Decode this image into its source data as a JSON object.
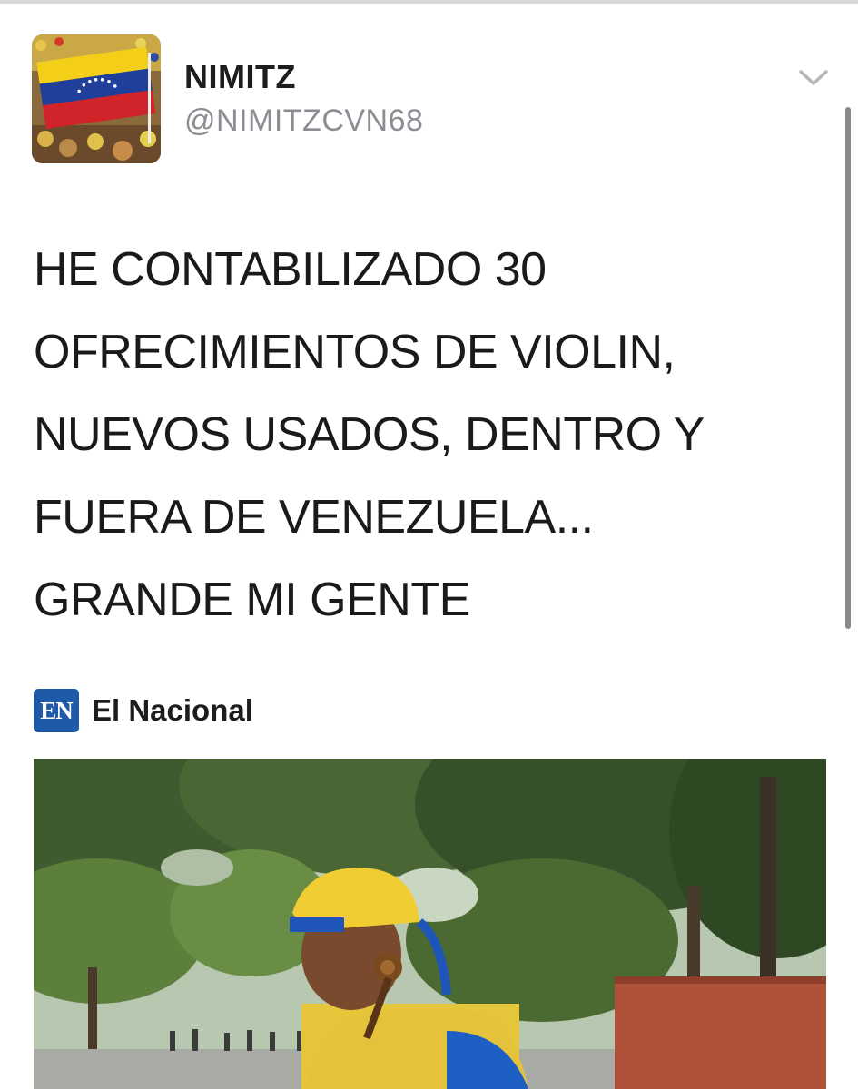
{
  "tweet": {
    "author": {
      "display_name": "NIMITZ",
      "handle": "@NIMITZCVN68"
    },
    "text_lines": [
      "HE CONTABILIZADO 30",
      "OFRECIMIENTOS DE VIOLIN,",
      "NUEVOS USADOS, DENTRO Y",
      "FUERA DE VENEZUELA...",
      "GRANDE MI GENTE"
    ],
    "card": {
      "source_logo": "EN",
      "source_name": "El Nacional"
    }
  },
  "icons": {
    "menu": "chevron-down-icon"
  },
  "colors": {
    "flag_yellow": "#f3cf1a",
    "flag_blue": "#1f3f9a",
    "flag_red": "#d0232a",
    "source_brand": "#1e5aa8"
  }
}
